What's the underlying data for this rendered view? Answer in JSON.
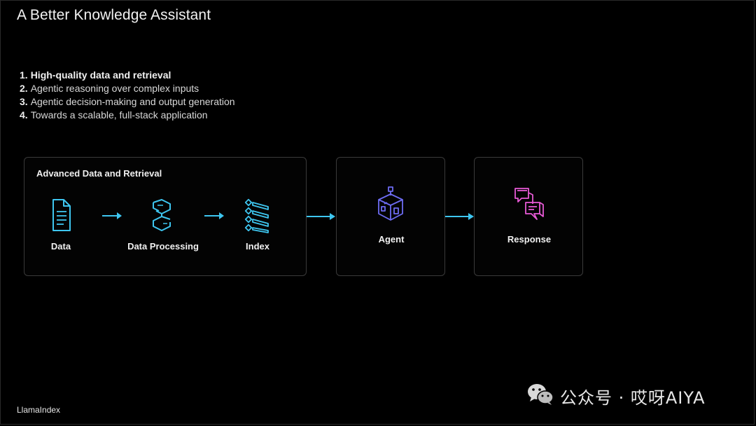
{
  "slide": {
    "title": "A Better Knowledge Assistant",
    "footer": "LlamaIndex"
  },
  "steps": [
    {
      "num": "1.",
      "text": "High-quality data and retrieval",
      "emphasis": true
    },
    {
      "num": "2.",
      "text": "Agentic reasoning over complex inputs",
      "emphasis": false
    },
    {
      "num": "3.",
      "text": "Agentic decision-making and output generation",
      "emphasis": false
    },
    {
      "num": "4.",
      "text": "Towards a scalable, full-stack application",
      "emphasis": false
    }
  ],
  "diagram": {
    "group_title": "Advanced Data and Retrieval",
    "nodes": {
      "data": {
        "label": "Data",
        "icon": "document-icon"
      },
      "processing": {
        "label": "Data Processing",
        "icon": "transform-icon"
      },
      "index": {
        "label": "Index",
        "icon": "index-stack-icon"
      },
      "agent": {
        "label": "Agent",
        "icon": "agent-house-icon"
      },
      "response": {
        "label": "Response",
        "icon": "chat-bubbles-icon"
      }
    },
    "colors": {
      "arrow": "#3ec6f0",
      "data_icon": "#3ec6f0",
      "agent_icon": "#6d6cf2",
      "response_icon": "#e85ad6",
      "box_border": "#3a3a3a"
    }
  },
  "watermark": {
    "text": "公众号 · 哎呀AIYA",
    "icon": "wechat-icon"
  }
}
